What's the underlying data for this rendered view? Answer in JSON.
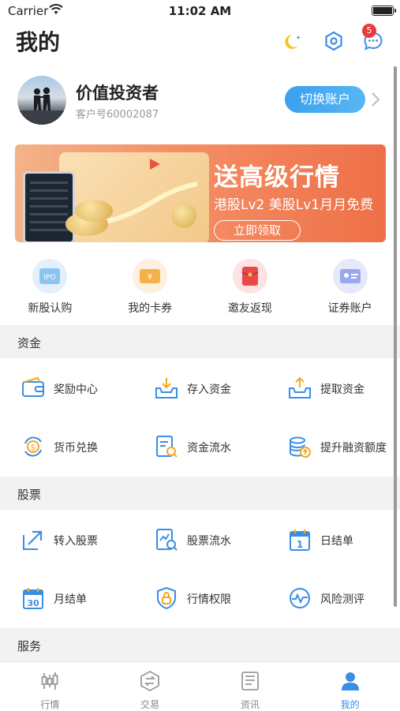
{
  "status_bar": {
    "carrier": "Carrier",
    "time": "11:02 AM"
  },
  "header": {
    "title": "我的",
    "notification_count": "5"
  },
  "profile": {
    "name": "价值投资者",
    "account": "客户号60002087",
    "switch_label": "切换账户"
  },
  "banner": {
    "headline": "送高级行情",
    "subtitle": "港股Lv2 美股Lv1月月免费",
    "cta": "立即领取"
  },
  "quick_actions": [
    {
      "label": "新股认购",
      "icon": "ipo-icon"
    },
    {
      "label": "我的卡券",
      "icon": "coupon-icon"
    },
    {
      "label": "邀友返现",
      "icon": "red-envelope-icon"
    },
    {
      "label": "证券账户",
      "icon": "id-card-icon"
    }
  ],
  "sections": {
    "funds": {
      "title": "资金",
      "items": [
        {
          "label": "奖励中心",
          "icon": "wallet-icon"
        },
        {
          "label": "存入资金",
          "icon": "deposit-icon"
        },
        {
          "label": "提取资金",
          "icon": "withdraw-icon"
        },
        {
          "label": "货币兑换",
          "icon": "currency-exchange-icon"
        },
        {
          "label": "资金流水",
          "icon": "fund-statement-icon"
        },
        {
          "label": "提升融资额度",
          "icon": "coin-stack-icon"
        }
      ]
    },
    "stocks": {
      "title": "股票",
      "items": [
        {
          "label": "转入股票",
          "icon": "transfer-in-icon"
        },
        {
          "label": "股票流水",
          "icon": "stock-statement-icon"
        },
        {
          "label": "日结单",
          "icon": "daily-calendar-icon"
        },
        {
          "label": "月结单",
          "icon": "monthly-calendar-icon"
        },
        {
          "label": "行情权限",
          "icon": "shield-lock-icon"
        },
        {
          "label": "风险测评",
          "icon": "risk-assessment-icon"
        }
      ]
    },
    "services": {
      "title": "服务"
    }
  },
  "calendar_digits": {
    "daily": "1",
    "monthly": "30"
  },
  "tabbar": [
    {
      "label": "行情",
      "icon": "candlestick-icon",
      "active": false
    },
    {
      "label": "交易",
      "icon": "trade-icon",
      "active": false
    },
    {
      "label": "资讯",
      "icon": "news-icon",
      "active": false
    },
    {
      "label": "我的",
      "icon": "user-icon",
      "active": true
    }
  ],
  "colors": {
    "accent": "#3a8ee6",
    "banner": "#f58e64",
    "badge": "#e83b3b"
  }
}
